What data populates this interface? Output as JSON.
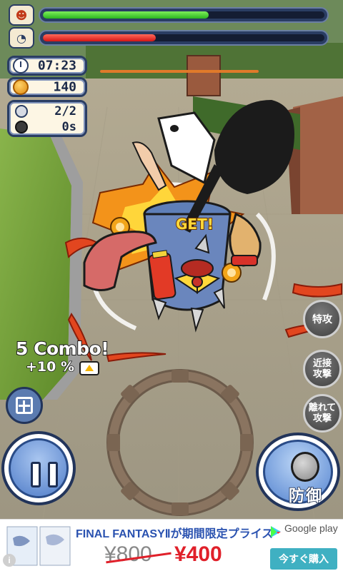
{
  "hud": {
    "player_hp_fraction": 0.59,
    "enemy_hp_fraction": 0.4,
    "enemy_sub_fraction": 1.0,
    "timer": "07:23",
    "coins": "140",
    "allies_count": "2/2",
    "bomb_time": "0s"
  },
  "combat": {
    "combo_label": "5 Combo!",
    "combo_bonus": "+10 %",
    "get_text": "GET!"
  },
  "buttons": {
    "skill_special": "特攻",
    "skill_melee": "近接\n攻撃",
    "skill_ranged": "離れて\n攻撃",
    "guard": "防御"
  },
  "ad": {
    "headline": "FINAL FANTASYⅡが期間限定プライス",
    "store": "Google play",
    "old_price": "¥800",
    "new_price": "¥400",
    "cta": "今すぐ購入",
    "info": "i"
  },
  "colors": {
    "hp_green": "#2bb51f",
    "enemy_red": "#d41616",
    "hud_navy": "#2a3d63",
    "ad_cta": "#3fb0c2"
  }
}
